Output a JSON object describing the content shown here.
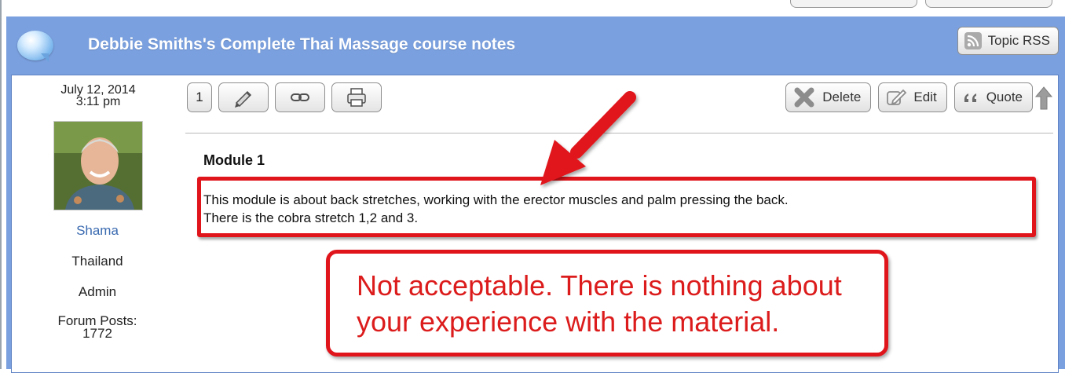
{
  "topic": {
    "title": "Debbie Smiths's Complete Thai Massage course notes",
    "rss_label": "Topic RSS"
  },
  "post": {
    "date": "July 12, 2014",
    "time": "3:11 pm",
    "number": "1",
    "author": {
      "name": "Shama",
      "location": "Thailand",
      "role": "Admin",
      "posts_label": "Forum Posts:",
      "posts_count": "1772"
    },
    "actions": {
      "delete": "Delete",
      "edit": "Edit",
      "quote": "Quote"
    },
    "heading": "Module 1",
    "body_lines": [
      "This module is about back stretches, working with the erector muscles and palm pressing the back.",
      "There is the cobra stretch 1,2 and 3."
    ]
  },
  "annotation": {
    "lines": [
      "Not acceptable. There is nothing about",
      "your experience with the material."
    ],
    "color": "#e0141b"
  },
  "icons": {
    "header": "speech-bubble-icon",
    "rss": "rss-icon",
    "tools": [
      "pencil-icon",
      "link-icon",
      "print-icon"
    ],
    "delete": "x-icon",
    "edit": "edit-icon",
    "quote": "quote-icon",
    "top": "up-arrow-icon"
  },
  "colors": {
    "header_bg": "#7aa0df",
    "link": "#3a6ab0"
  }
}
